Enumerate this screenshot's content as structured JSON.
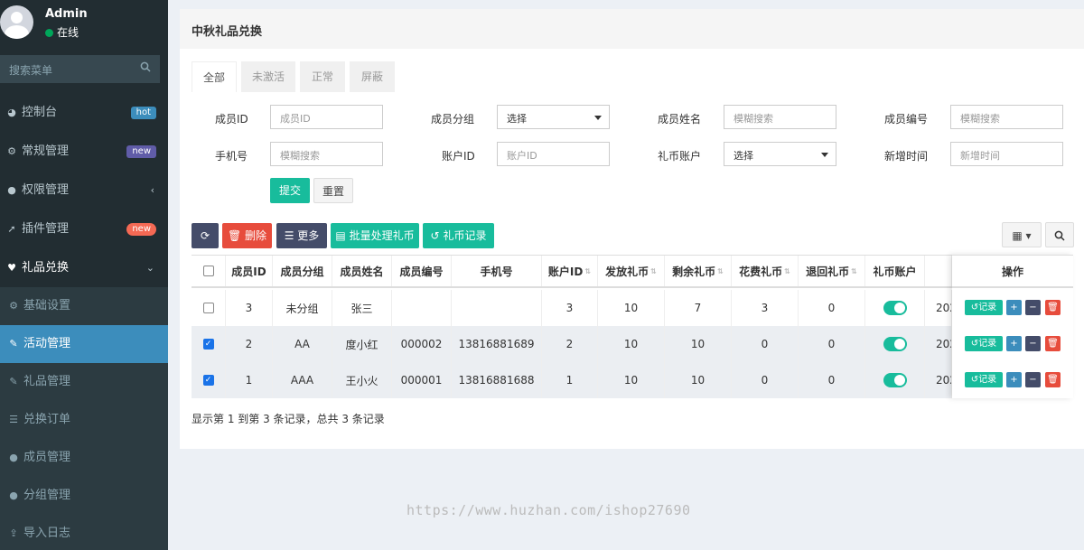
{
  "user": {
    "name": "Admin",
    "status": "在线"
  },
  "sidebar_search": {
    "placeholder": "搜索菜单"
  },
  "menu": [
    {
      "label": "控制台",
      "icon": "dashboard-icon",
      "badge": "hot"
    },
    {
      "label": "常规管理",
      "icon": "cogs-icon",
      "badge": "new"
    },
    {
      "label": "权限管理",
      "icon": "group-icon",
      "chevron": "‹"
    },
    {
      "label": "插件管理",
      "icon": "rocket-icon",
      "badge": "new"
    },
    {
      "label": "礼品兑换",
      "icon": "heart-icon",
      "chevron": "⌄"
    }
  ],
  "submenu": [
    {
      "label": "基础设置",
      "icon": "cogs-icon"
    },
    {
      "label": "活动管理",
      "icon": "fire-icon"
    },
    {
      "label": "礼品管理",
      "icon": "fire-icon"
    },
    {
      "label": "兑换订单",
      "icon": "list-icon"
    },
    {
      "label": "成员管理",
      "icon": "user-icon"
    },
    {
      "label": "分组管理",
      "icon": "group-icon"
    },
    {
      "label": "导入日志",
      "icon": "upload-icon"
    }
  ],
  "page": {
    "title": "中秋礼品兑换"
  },
  "tabs": [
    "全部",
    "未激活",
    "正常",
    "屏蔽"
  ],
  "filters": {
    "member_id": {
      "label": "成员ID",
      "placeholder": "成员ID"
    },
    "member_group": {
      "label": "成员分组",
      "value": "选择"
    },
    "member_name": {
      "label": "成员姓名",
      "placeholder": "模糊搜索"
    },
    "member_no": {
      "label": "成员编号",
      "placeholder": "模糊搜索"
    },
    "phone": {
      "label": "手机号",
      "placeholder": "模糊搜索"
    },
    "account_id": {
      "label": "账户ID",
      "placeholder": "账户ID"
    },
    "coin_account": {
      "label": "礼币账户",
      "value": "选择"
    },
    "created": {
      "label": "新增时间",
      "placeholder": "新增时间"
    },
    "submit": "提交",
    "reset": "重置"
  },
  "toolbar": {
    "delete": "删除",
    "more": "更多",
    "batch": "批量处理礼币",
    "log": "礼币记录"
  },
  "table": {
    "headers": [
      "成员ID",
      "成员分组",
      "成员姓名",
      "成员编号",
      "手机号",
      "账户ID",
      "发放礼币",
      "剩余礼币",
      "花费礼币",
      "退回礼币",
      "礼币账户",
      "操作"
    ],
    "rows": [
      {
        "checked": false,
        "id": "3",
        "group": "未分组",
        "name": "张三",
        "no": "",
        "phone": "",
        "account": "3",
        "issued": "10",
        "remain": "7",
        "spent": "3",
        "returned": "0",
        "account_on": true,
        "date": "202"
      },
      {
        "checked": true,
        "id": "2",
        "group": "AA",
        "name": "度小红",
        "no": "000002",
        "phone": "13816881689",
        "account": "2",
        "issued": "10",
        "remain": "10",
        "spent": "0",
        "returned": "0",
        "account_on": true,
        "date": "202"
      },
      {
        "checked": true,
        "id": "1",
        "group": "AAA",
        "name": "王小火",
        "no": "000001",
        "phone": "13816881688",
        "account": "1",
        "issued": "10",
        "remain": "10",
        "spent": "0",
        "returned": "0",
        "account_on": true,
        "date": "202"
      }
    ],
    "record_label": "记录"
  },
  "pagination": {
    "summary": "显示第 1 到第 3 条记录，总共 3 条记录"
  },
  "watermark": "https://www.huzhan.com/ishop27690",
  "colors": {
    "sidebar": "#222d32",
    "active": "#3c8dbc",
    "teal": "#18bc9c",
    "danger": "#e74c3c",
    "dark": "#444c69"
  }
}
